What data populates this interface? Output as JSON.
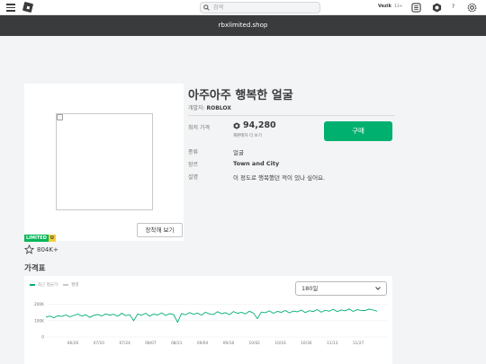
{
  "topnav": {
    "search_placeholder": "검색",
    "username": "Vezik",
    "age_label": "13+",
    "help_label": "?"
  },
  "domain_bar": {
    "text": "rbxlimited.shop"
  },
  "item": {
    "title": "아주아주 행복한 얼굴",
    "creator_label": "개발자:",
    "creator_name": "ROBLOX",
    "price_label": "최저 가격",
    "price": "94,280",
    "resellers_link": "재판매자 더 보기",
    "buy_label": "구매",
    "type_label": "종류",
    "type_value": "얼굴",
    "genre_label": "장르",
    "genre_value": "Town and City",
    "desc_label": "설명",
    "desc_value": "이 정도로 행복했던 적이 있나 싶어요.",
    "tryon_label": "장착해 보기",
    "badge_limited": "LIMITED",
    "badge_u": "U",
    "favorites": "804K+"
  },
  "chart_section": {
    "title": "가격표",
    "range_select": "180일"
  },
  "colors": {
    "buy": "#00b06f",
    "limited": "#02b757",
    "unique": "#f5cf3a",
    "line": "#00b06f",
    "nav_dark": "#393b3d"
  },
  "chart_data": {
    "type": "line",
    "legend": [
      "최근 평균가",
      "월별"
    ],
    "y_ticks": [
      "200K",
      "100K",
      "0"
    ],
    "ylim": [
      0,
      220000
    ],
    "x_ticks": [
      "06/26",
      "07/10",
      "07/24",
      "08/07",
      "08/21",
      "09/04",
      "09/18",
      "10/02",
      "10/16",
      "10/30",
      "11/13",
      "11/27"
    ],
    "series": [
      {
        "name": "최근 평균가",
        "values": [
          122000,
          128000,
          118000,
          130000,
          126000,
          135000,
          124000,
          132000,
          140000,
          128000,
          136000,
          120000,
          133000,
          138000,
          129000,
          142000,
          134000,
          139000,
          127000,
          145000,
          131000,
          137000,
          100000,
          141000,
          133000,
          146000,
          128000,
          140000,
          135000,
          148000,
          132000,
          143000,
          138000,
          90000,
          144000,
          136000,
          150000,
          139000,
          147000,
          134000,
          152000,
          141000,
          138000,
          155000,
          143000,
          149000,
          137000,
          156000,
          145000,
          151000,
          142000,
          158000,
          147000,
          112000,
          153000,
          149000,
          160000,
          146000,
          157000,
          151000,
          162000,
          148000,
          159000,
          154000,
          165000,
          150000,
          161000,
          156000,
          168000,
          152000,
          164000,
          158000,
          170000,
          155000,
          166000,
          160000,
          172000,
          157000,
          168000,
          163000,
          162000,
          171000,
          165000,
          158000
        ]
      }
    ]
  }
}
